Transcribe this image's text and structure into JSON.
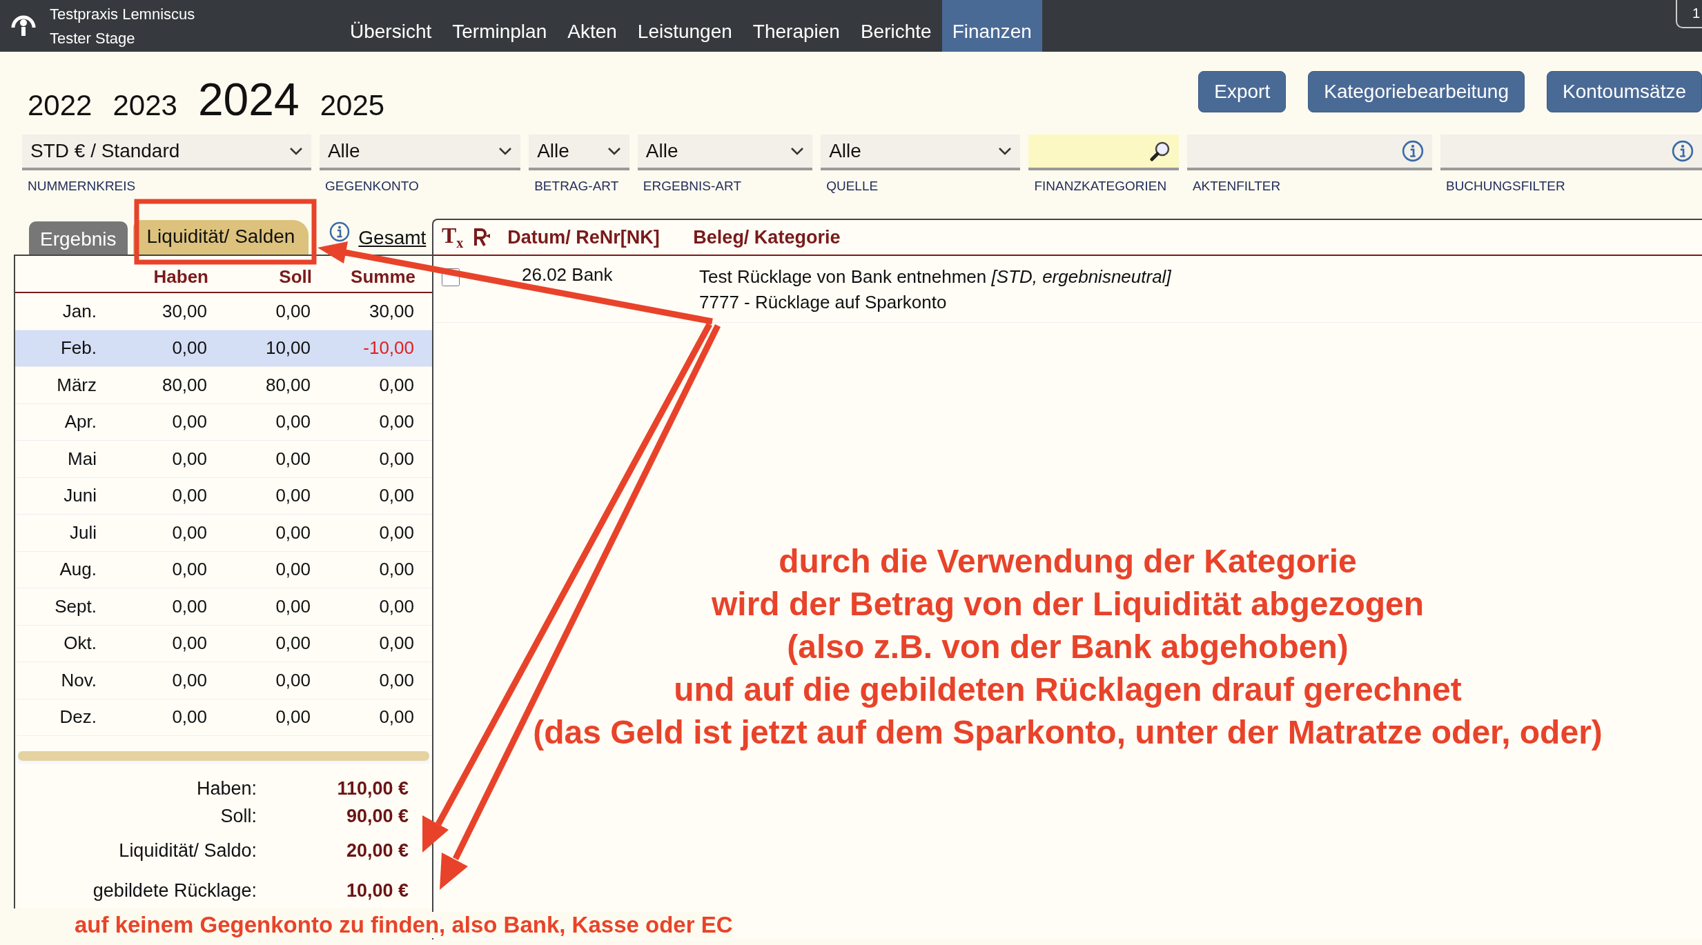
{
  "app": {
    "practice": "Testpraxis Lemniscus",
    "user": "Tester Stage",
    "corner_badge": "1"
  },
  "nav": [
    {
      "label": "Übersicht",
      "selected": false
    },
    {
      "label": "Terminplan",
      "selected": false
    },
    {
      "label": "Akten",
      "selected": false
    },
    {
      "label": "Leistungen",
      "selected": false
    },
    {
      "label": "Therapien",
      "selected": false
    },
    {
      "label": "Berichte",
      "selected": false
    },
    {
      "label": "Finanzen",
      "selected": true
    }
  ],
  "years": [
    {
      "label": "2022",
      "selected": false
    },
    {
      "label": "2023",
      "selected": false
    },
    {
      "label": "2024",
      "selected": true
    },
    {
      "label": "2025",
      "selected": false
    }
  ],
  "buttons": [
    "Export",
    "Kategoriebearbeitung",
    "Kontoumsätze"
  ],
  "filters": [
    {
      "kind": "select",
      "value": "STD € / Standard",
      "label": "NUMMERNKREIS"
    },
    {
      "kind": "select",
      "value": "Alle",
      "label": "GEGENKONTO"
    },
    {
      "kind": "select",
      "value": "Alle",
      "label": "BETRAG-ART"
    },
    {
      "kind": "select",
      "value": "Alle",
      "label": "ERGEBNIS-ART"
    },
    {
      "kind": "select",
      "value": "Alle",
      "label": "QUELLE"
    },
    {
      "kind": "search",
      "label": "FINANZKATEGORIEN"
    },
    {
      "kind": "info",
      "label": "AKTENFILTER"
    },
    {
      "kind": "info",
      "label": "BUCHUNGSFILTER"
    }
  ],
  "result_tabs": [
    {
      "label": "Ergebnis",
      "selected": false
    },
    {
      "label": "Liquidität/ Salden",
      "selected": true
    }
  ],
  "total_link": "Gesamt",
  "month_table": {
    "columns": [
      "Haben",
      "Soll",
      "Summe"
    ],
    "rows": [
      {
        "month": "Jan.",
        "haben": "30,00",
        "soll": "0,00",
        "summe": "30,00",
        "selected": false,
        "negative": false
      },
      {
        "month": "Feb.",
        "haben": "0,00",
        "soll": "10,00",
        "summe": "-10,00",
        "selected": true,
        "negative": true
      },
      {
        "month": "März",
        "haben": "80,00",
        "soll": "80,00",
        "summe": "0,00",
        "selected": false,
        "negative": false
      },
      {
        "month": "Apr.",
        "haben": "0,00",
        "soll": "0,00",
        "summe": "0,00",
        "selected": false,
        "negative": false
      },
      {
        "month": "Mai",
        "haben": "0,00",
        "soll": "0,00",
        "summe": "0,00",
        "selected": false,
        "negative": false
      },
      {
        "month": "Juni",
        "haben": "0,00",
        "soll": "0,00",
        "summe": "0,00",
        "selected": false,
        "negative": false
      },
      {
        "month": "Juli",
        "haben": "0,00",
        "soll": "0,00",
        "summe": "0,00",
        "selected": false,
        "negative": false
      },
      {
        "month": "Aug.",
        "haben": "0,00",
        "soll": "0,00",
        "summe": "0,00",
        "selected": false,
        "negative": false
      },
      {
        "month": "Sept.",
        "haben": "0,00",
        "soll": "0,00",
        "summe": "0,00",
        "selected": false,
        "negative": false
      },
      {
        "month": "Okt.",
        "haben": "0,00",
        "soll": "0,00",
        "summe": "0,00",
        "selected": false,
        "negative": false
      },
      {
        "month": "Nov.",
        "haben": "0,00",
        "soll": "0,00",
        "summe": "0,00",
        "selected": false,
        "negative": false
      },
      {
        "month": "Dez.",
        "haben": "0,00",
        "soll": "0,00",
        "summe": "0,00",
        "selected": false,
        "negative": false
      }
    ]
  },
  "summary": [
    {
      "label": "Haben:",
      "value": "110,00 €"
    },
    {
      "label": "Soll:",
      "value": "90,00 €"
    },
    {
      "label": "Liquidität/ Saldo:",
      "value": "20,00 €"
    },
    {
      "label": "gebildete Rücklage:",
      "value": "10,00 €"
    }
  ],
  "bookings": {
    "format_icon": "T$_{x}$",
    "columns": [
      "Datum/ ReNr[NK]",
      "Beleg/ Kategorie"
    ],
    "rows": [
      {
        "checked": false,
        "date_account": "26.02 Bank",
        "text": "Test Rücklage von Bank entnehmen *[STD, ergebnisneutral]*",
        "category": "7777 - Rücklage auf Sparkonto"
      }
    ]
  },
  "annotation": {
    "lines": [
      "durch die Verwendung der Kategorie",
      "wird der Betrag von der Liquidität abgezogen",
      "(also z.B. von der Bank abgehoben)",
      "und auf die gebildeten Rücklagen drauf gerechnet",
      "(das Geld ist jetzt auf dem Sparkonto, unter der Matratze oder, oder)"
    ],
    "footnote": "auf keinem Gegenkonto zu finden, also Bank, Kasse oder EC"
  }
}
